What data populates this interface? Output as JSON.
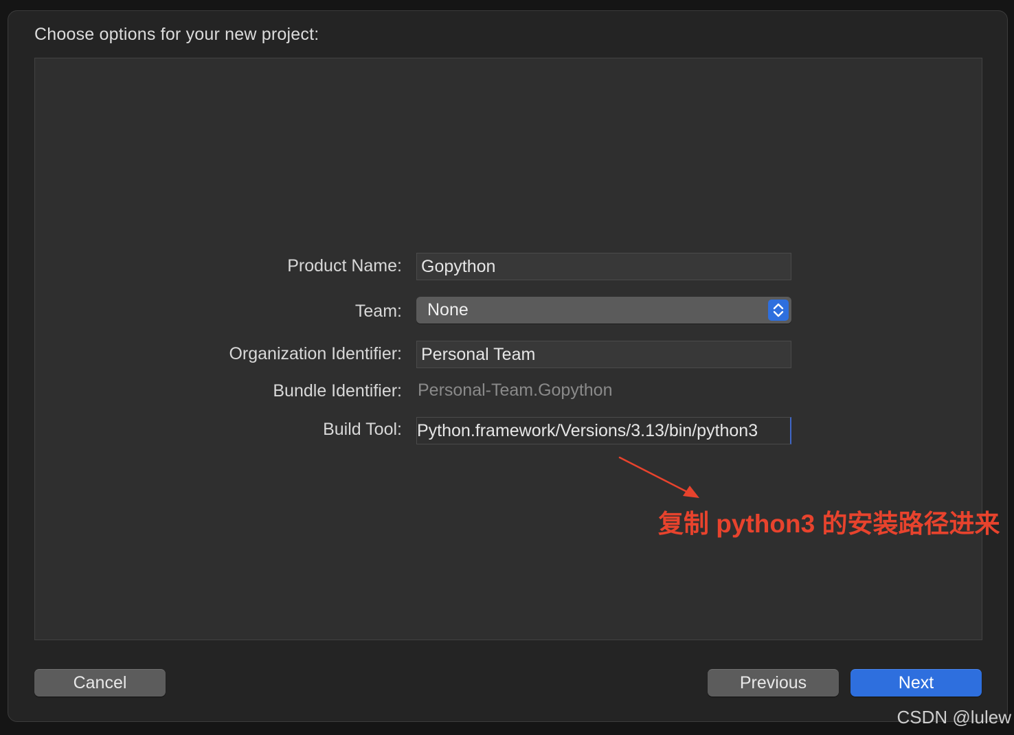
{
  "dialog": {
    "title": "Choose options for your new project:"
  },
  "form": {
    "product_name": {
      "label": "Product Name:",
      "value": "Gopython"
    },
    "team": {
      "label": "Team:",
      "value": "None"
    },
    "organization_identifier": {
      "label": "Organization Identifier:",
      "value": "Personal Team"
    },
    "bundle_identifier": {
      "label": "Bundle Identifier:",
      "value": "Personal-Team.Gopython"
    },
    "build_tool": {
      "label": "Build Tool:",
      "value": "Python.framework/Versions/3.13/bin/python3"
    }
  },
  "annotation": {
    "text": "复制 python3 的安装路径进来",
    "color": "#e8432d"
  },
  "buttons": {
    "cancel": "Cancel",
    "previous": "Previous",
    "next": "Next"
  },
  "colors": {
    "accent": "#2e6fde",
    "background": "#242424",
    "panel": "#2f2f2f"
  },
  "icons": {
    "popup_stepper": "chevron-up-down-icon",
    "annotation_arrow": "arrow-icon"
  },
  "watermark": "CSDN @lulew"
}
